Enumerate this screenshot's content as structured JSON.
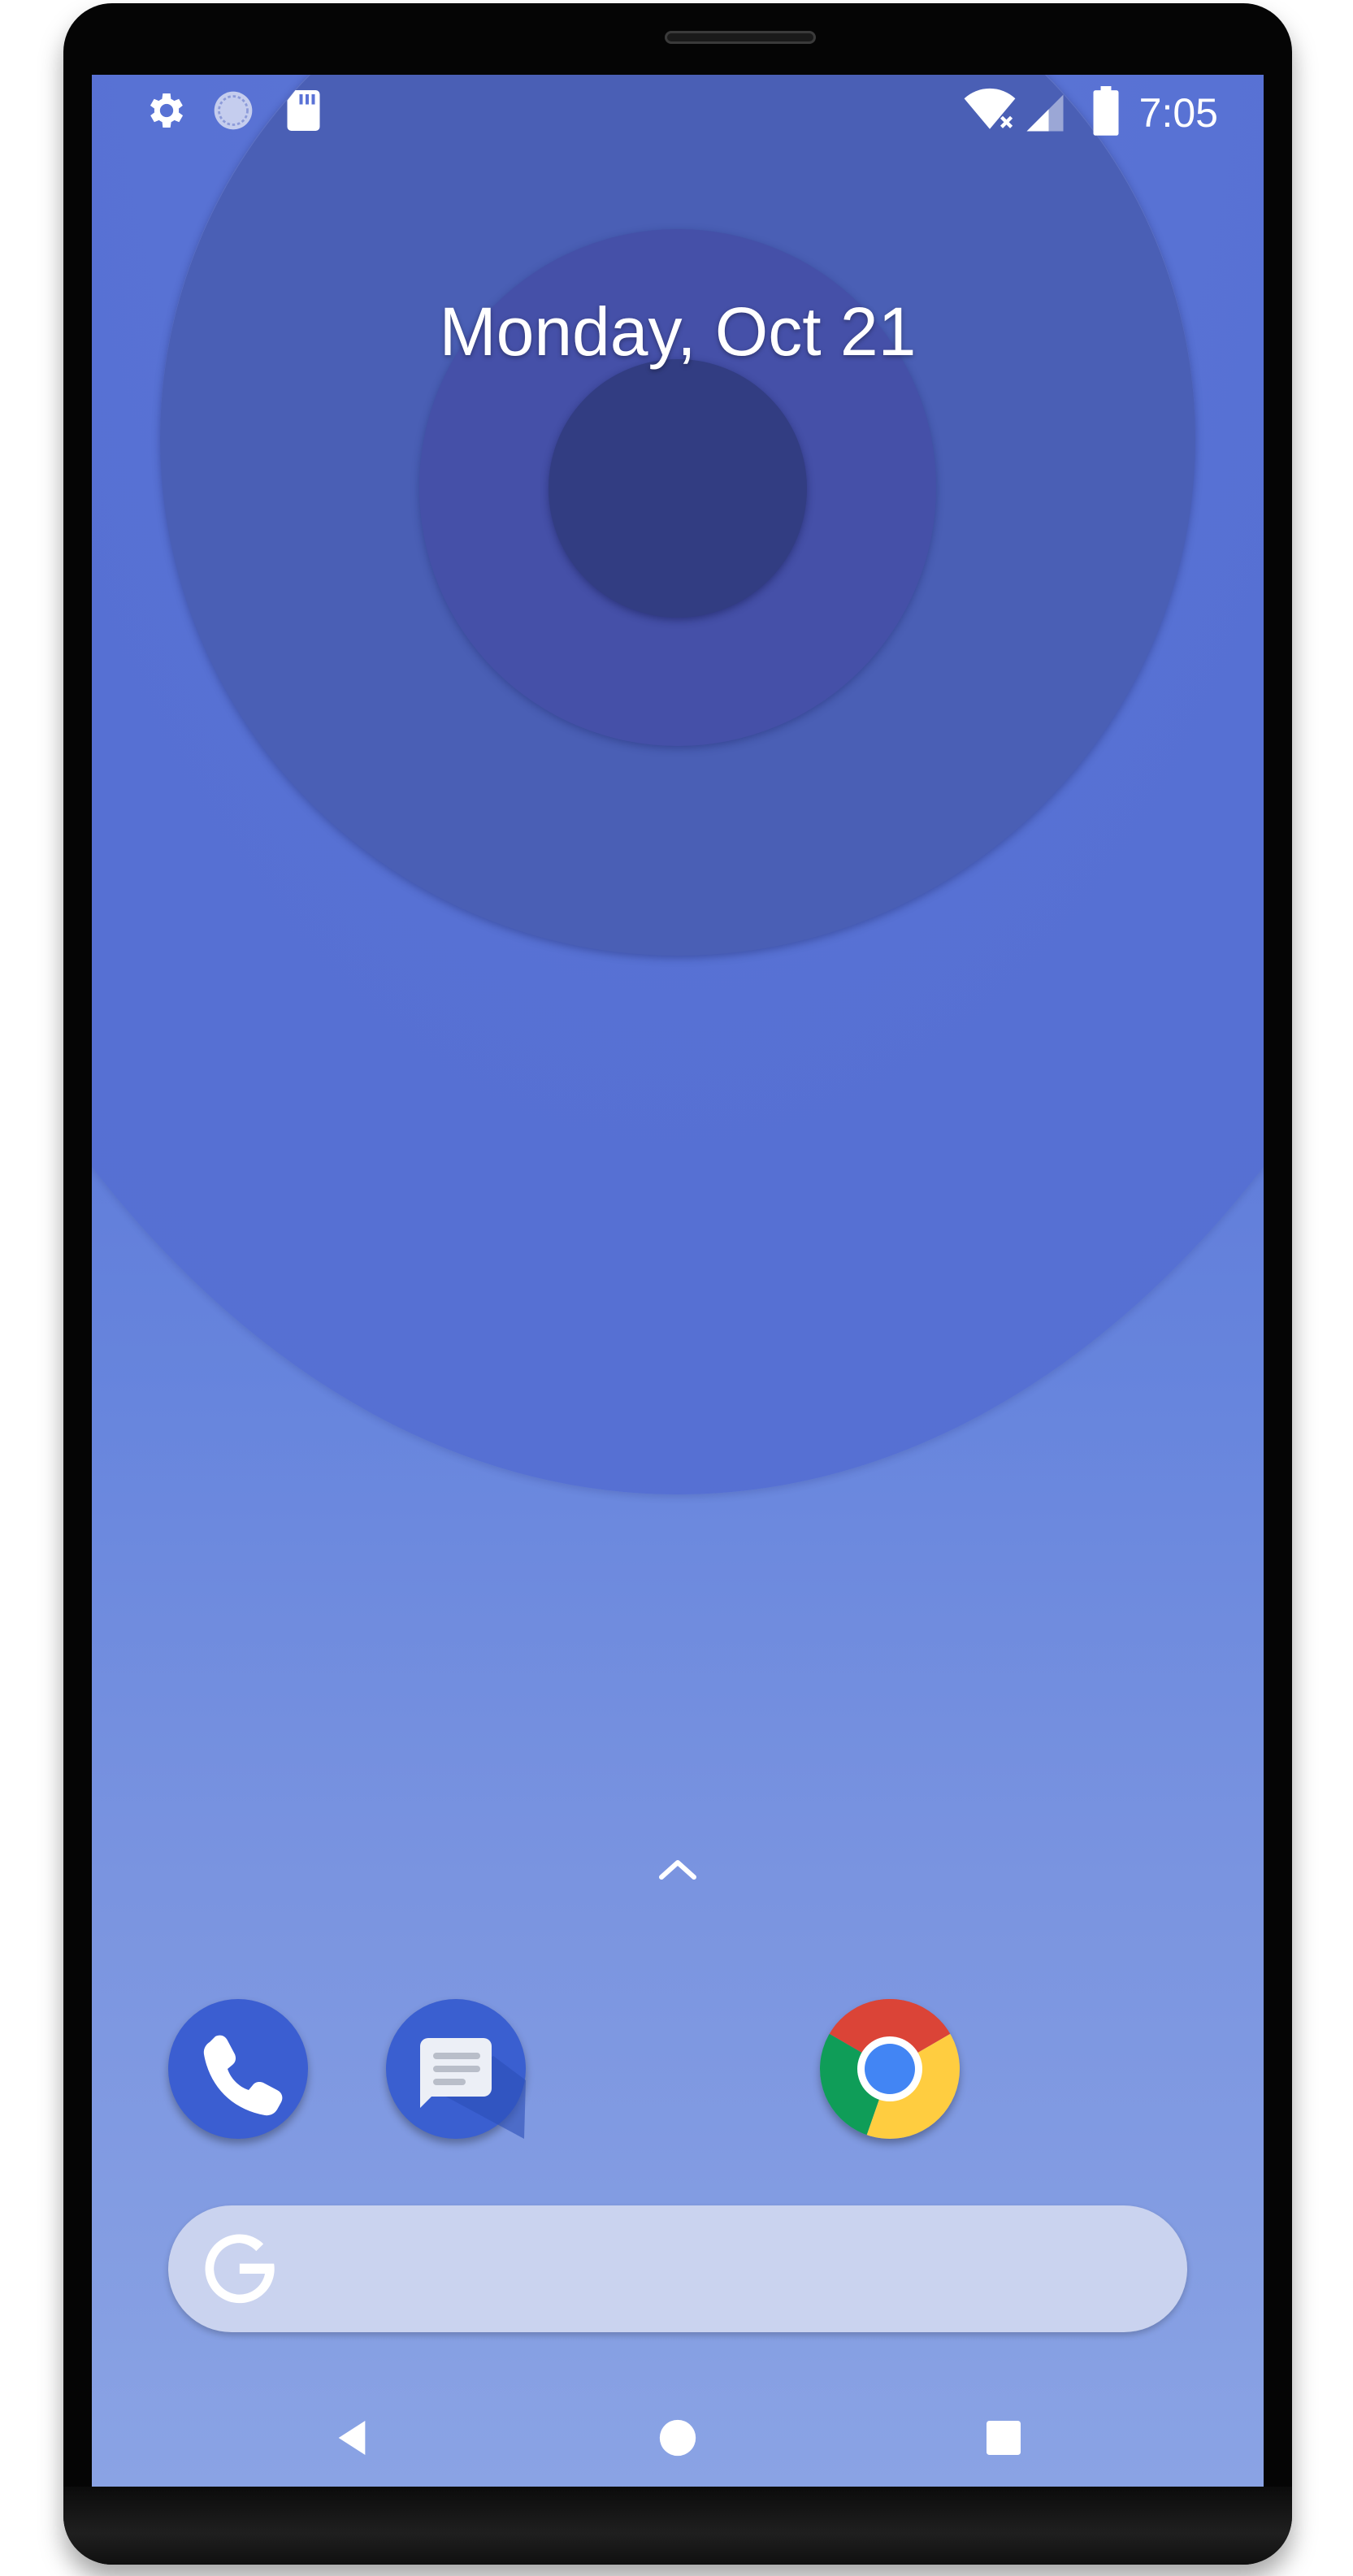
{
  "status_bar": {
    "time": "7:05",
    "left_icons": [
      "settings-icon",
      "sync-icon",
      "sd-card-icon"
    ],
    "right_icons": [
      "wifi-no-internet-icon",
      "cell-signal-icon",
      "battery-icon"
    ]
  },
  "home": {
    "date": "Monday, Oct 21"
  },
  "dock": {
    "apps": [
      {
        "name": "Phone",
        "icon": "phone-icon"
      },
      {
        "name": "Messages",
        "icon": "messages-icon"
      },
      {
        "name": "Chrome",
        "icon": "chrome-icon"
      }
    ]
  },
  "search": {
    "icon": "google-g-icon",
    "placeholder": ""
  },
  "nav_bar": {
    "buttons": [
      "back-icon",
      "home-icon",
      "recents-icon"
    ]
  },
  "colors": {
    "wallpaper_top": "#5a72d6",
    "wallpaper_bottom": "#8aa3e4",
    "dock_blue": "#3b5fcf",
    "search_bar": "#cad3ef"
  }
}
